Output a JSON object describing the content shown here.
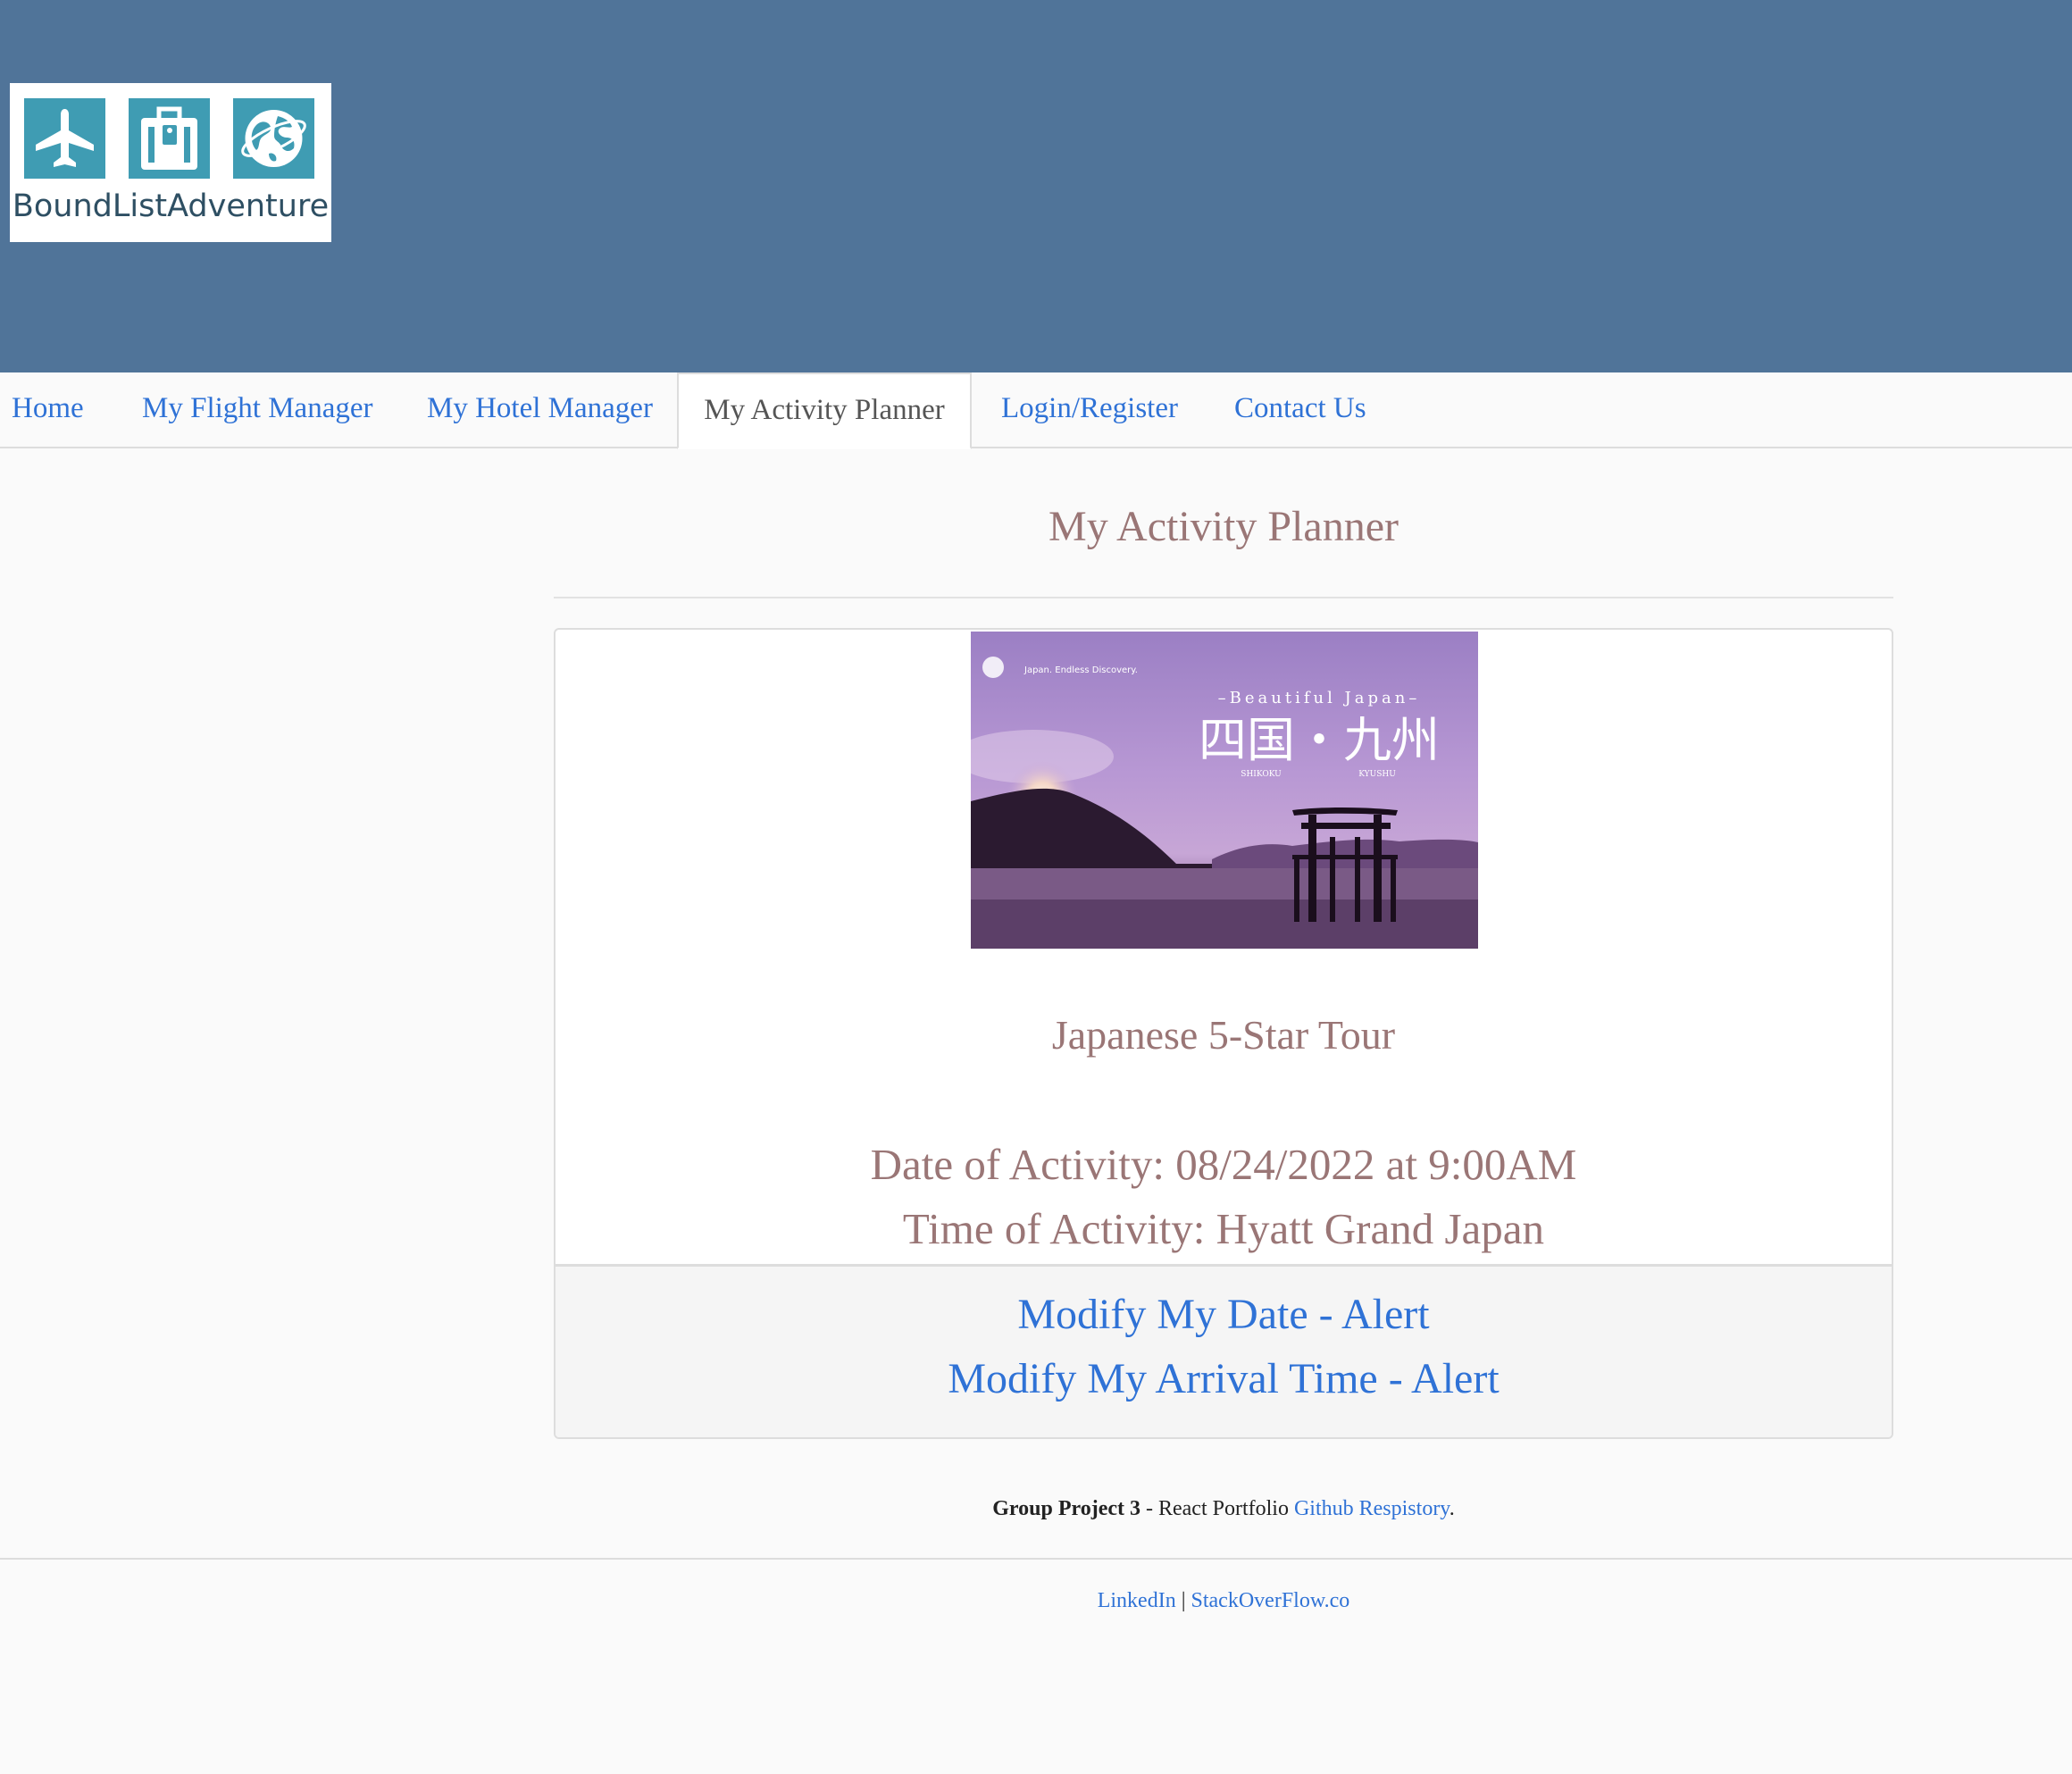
{
  "brand": {
    "logo_text": "BoundListAdventure",
    "logo_color": "#3f9cb3",
    "header_color": "#507499"
  },
  "nav": {
    "items": [
      {
        "label": "Home",
        "icon": ""
      },
      {
        "label": "My Flight Manager"
      },
      {
        "label": "My Hotel Manager"
      },
      {
        "label": "My Activity Planner",
        "active": true
      },
      {
        "label": "Login/Register"
      },
      {
        "label": "Contact Us"
      }
    ]
  },
  "main": {
    "page_title": "My Activity Planner",
    "activity": {
      "image": {
        "subtitle": "–Beautiful Japan–",
        "kanji": "四国・九州",
        "label_left": "SHIKOKU",
        "label_right": "KYUSHU",
        "brand_small": "Japan. Endless Discovery."
      },
      "name": "Japanese 5-Star Tour",
      "date_line": "Date of Activity: 08/24/2022 at 9:00AM",
      "time_line": "Time of Activity: Hyatt Grand Japan",
      "modify_date_link": "Modify My Date - Alert",
      "modify_time_link": "Modify My Arrival Time - Alert"
    }
  },
  "footer": {
    "credit_bold": "Group Project 3",
    "credit_text": " - React Portfolio ",
    "credit_link": "Github Respistory",
    "credit_end": ".",
    "linkedin": "LinkedIn",
    "separator": " | ",
    "stackoverflow": "StackOverFlow.co"
  }
}
